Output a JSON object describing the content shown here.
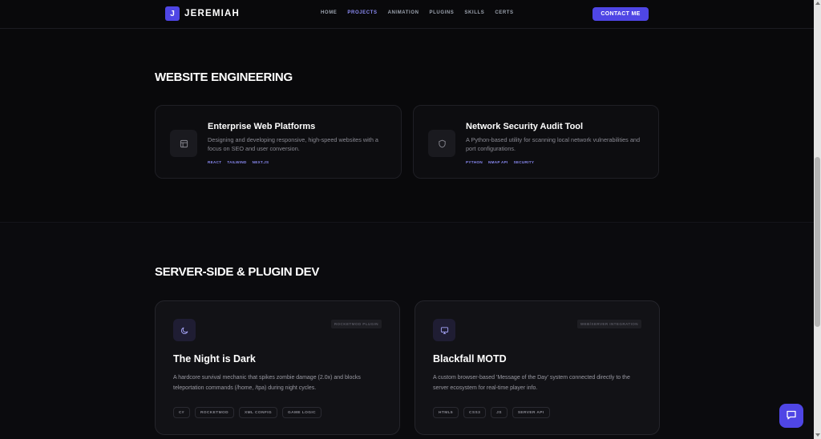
{
  "header": {
    "brand_letter": "J",
    "brand_name": "JEREMIAH",
    "nav": [
      {
        "label": "HOME",
        "active": false
      },
      {
        "label": "PROJECTS",
        "active": true
      },
      {
        "label": "ANIMATION",
        "active": false
      },
      {
        "label": "PLUGINS",
        "active": false
      },
      {
        "label": "SKILLS",
        "active": false
      },
      {
        "label": "CERTS",
        "active": false
      }
    ],
    "contact_label": "CONTACT ME"
  },
  "web_section": {
    "title": "WEBSITE ENGINEERING",
    "cards": [
      {
        "icon": "layout-icon",
        "title": "Enterprise Web Platforms",
        "description": "Designing and developing responsive, high-speed websites with a focus on SEO and user conversion.",
        "tags": [
          "REACT",
          "TAILWIND",
          "NEXT.JS"
        ]
      },
      {
        "icon": "shield-icon",
        "title": "Network Security Audit Tool",
        "description": "A Python-based utility for scanning local network vulnerabilities and port configurations.",
        "tags": [
          "PYTHON",
          "NMAP API",
          "SECURITY"
        ]
      }
    ]
  },
  "server_section": {
    "title": "SERVER-SIDE & PLUGIN DEV",
    "cards": [
      {
        "icon": "moon-icon",
        "badge": "ROCKETMOD PLUGIN",
        "title": "The Night is Dark",
        "description": "A hardcore survival mechanic that spikes zombie damage (2.0x) and blocks teleportation commands (/home, /tpa) during night cycles.",
        "chips": [
          "C#",
          "ROCKETMOD",
          "XML CONFIG",
          "GAME LOGIC"
        ]
      },
      {
        "icon": "monitor-icon",
        "badge": "WEB/SERVER INTEGRATION",
        "title": "Blackfall MOTD",
        "description": "A custom browser-based 'Message of the Day' system connected directly to the server ecosystem for real-time player info.",
        "chips": [
          "HTML5",
          "CSS3",
          "JS",
          "SERVER API"
        ]
      }
    ]
  },
  "colors": {
    "accent": "#4f46e5",
    "accent_text": "#8b8bf5",
    "background": "#09090b"
  }
}
